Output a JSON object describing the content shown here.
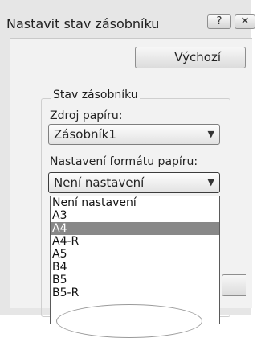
{
  "window": {
    "title": "Nastavit stav zásobníku"
  },
  "titlebar": {
    "help_label": "?",
    "close_label": "✕"
  },
  "buttons": {
    "default_label": "Výchozí",
    "ok_label": ""
  },
  "group": {
    "legend": "Stav zásobníku",
    "source_label": "Zdroj papíru:",
    "source_value": "Zásobník1",
    "format_label": "Nastavení formátu papíru:",
    "format_value": "Není nastavení"
  },
  "dropdown": {
    "items": [
      "Není nastavení",
      "A3",
      "A4",
      "A4-R",
      "A5",
      "B4",
      "B5",
      "B5-R"
    ],
    "selected": "A4"
  },
  "icons": {
    "dropdown_arrow": "chevron-down-icon"
  }
}
